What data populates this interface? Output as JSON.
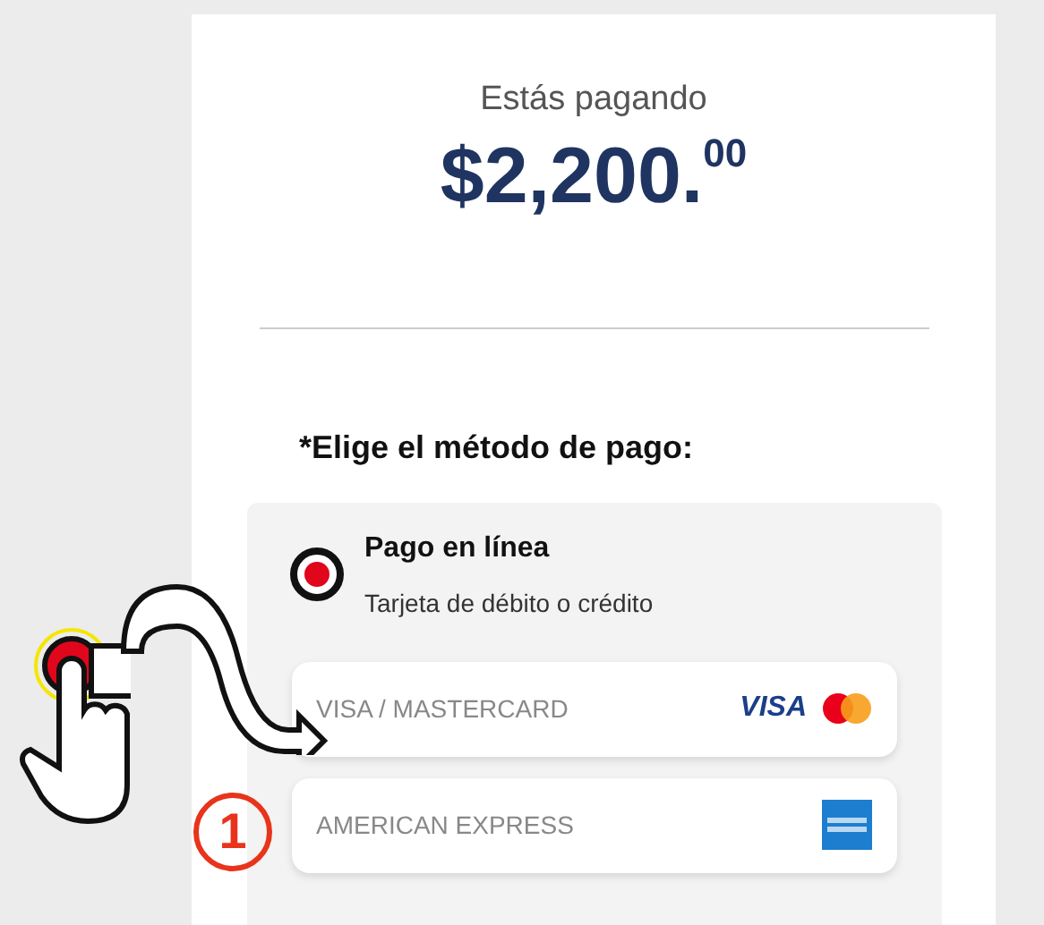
{
  "header": {
    "label": "Estás pagando",
    "amount": "$2,200.$^{00}$"
  },
  "section_title": "*Elige el método de pago:",
  "method": {
    "title": "Pago en línea",
    "subtitle": "Tarjeta de débito o crédito",
    "selected": true
  },
  "cards": [
    {
      "label": "VISA / MASTERCARD",
      "kind": "visa_mastercard",
      "logo_text": "VISA"
    },
    {
      "label": "AMERICAN EXPRESS",
      "kind": "amex"
    }
  ],
  "annotation": {
    "step": "1"
  }
}
